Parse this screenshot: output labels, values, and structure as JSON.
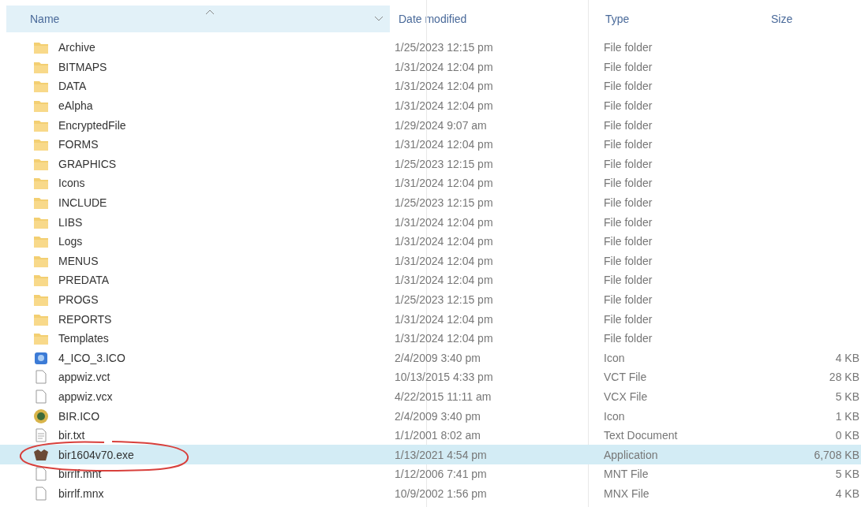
{
  "columns": [
    "Name",
    "Date modified",
    "Type",
    "Size"
  ],
  "rows": [
    {
      "kind": "folder",
      "name": "Archive",
      "date": "1/25/2023 12:15 pm",
      "type": "File folder",
      "selected": false,
      "circled": false
    },
    {
      "kind": "folder",
      "name": "BITMAPS",
      "date": "1/31/2024 12:04 pm",
      "type": "File folder",
      "selected": false,
      "circled": false
    },
    {
      "kind": "folder",
      "name": "DATA",
      "date": "1/31/2024 12:04 pm",
      "type": "File folder",
      "selected": false,
      "circled": false
    },
    {
      "kind": "folder",
      "name": "eAlpha",
      "date": "1/31/2024 12:04 pm",
      "type": "File folder",
      "selected": false,
      "circled": false
    },
    {
      "kind": "folder",
      "name": "EncryptedFile",
      "date": "1/29/2024 9:07 am",
      "type": "File folder",
      "selected": false,
      "circled": false
    },
    {
      "kind": "folder",
      "name": "FORMS",
      "date": "1/31/2024 12:04 pm",
      "type": "File folder",
      "selected": false,
      "circled": false
    },
    {
      "kind": "folder",
      "name": "GRAPHICS",
      "date": "1/25/2023 12:15 pm",
      "type": "File folder",
      "selected": false,
      "circled": false
    },
    {
      "kind": "folder",
      "name": "Icons",
      "date": "1/31/2024 12:04 pm",
      "type": "File folder",
      "selected": false,
      "circled": false
    },
    {
      "kind": "folder",
      "name": "INCLUDE",
      "date": "1/25/2023 12:15 pm",
      "type": "File folder",
      "selected": false,
      "circled": false
    },
    {
      "kind": "folder",
      "name": "LIBS",
      "date": "1/31/2024 12:04 pm",
      "type": "File folder",
      "selected": false,
      "circled": false
    },
    {
      "kind": "folder",
      "name": "Logs",
      "date": "1/31/2024 12:04 pm",
      "type": "File folder",
      "selected": false,
      "circled": false
    },
    {
      "kind": "folder",
      "name": "MENUS",
      "date": "1/31/2024 12:04 pm",
      "type": "File folder",
      "selected": false,
      "circled": false
    },
    {
      "kind": "folder",
      "name": "PREDATA",
      "date": "1/31/2024 12:04 pm",
      "type": "File folder",
      "selected": false,
      "circled": false
    },
    {
      "kind": "folder",
      "name": "PROGS",
      "date": "1/25/2023 12:15 pm",
      "type": "File folder",
      "selected": false,
      "circled": false
    },
    {
      "kind": "folder",
      "name": "REPORTS",
      "date": "1/31/2024 12:04 pm",
      "type": "File folder",
      "selected": false,
      "circled": false
    },
    {
      "kind": "folder",
      "name": "Templates",
      "date": "1/31/2024 12:04 pm",
      "type": "File folder",
      "selected": false,
      "circled": false
    },
    {
      "kind": "ico",
      "name": "4_ICO_3.ICO",
      "date": "2/4/2009 3:40 pm",
      "type": "Icon",
      "size": "4 KB",
      "selected": false,
      "circled": false
    },
    {
      "kind": "file",
      "name": "appwiz.vct",
      "date": "10/13/2015 4:33 pm",
      "type": "VCT File",
      "size": "28 KB",
      "selected": false,
      "circled": false
    },
    {
      "kind": "file",
      "name": "appwiz.vcx",
      "date": "4/22/2015 11:11 am",
      "type": "VCX File",
      "size": "5 KB",
      "selected": false,
      "circled": false
    },
    {
      "kind": "emblem",
      "name": "BIR.ICO",
      "date": "2/4/2009 3:40 pm",
      "type": "Icon",
      "size": "1 KB",
      "selected": false,
      "circled": false
    },
    {
      "kind": "text",
      "name": "bir.txt",
      "date": "1/1/2001 8:02 am",
      "type": "Text Document",
      "size": "0 KB",
      "selected": false,
      "circled": false
    },
    {
      "kind": "exe",
      "name": "bir1604v70.exe",
      "date": "1/13/2021 4:54 pm",
      "type": "Application",
      "size": "6,708 KB",
      "selected": true,
      "circled": true
    },
    {
      "kind": "file",
      "name": "birrlf.mnt",
      "date": "1/12/2006 7:41 pm",
      "type": "MNT File",
      "size": "5 KB",
      "selected": false,
      "circled": false
    },
    {
      "kind": "file",
      "name": "birrlf.mnx",
      "date": "10/9/2002 1:56 pm",
      "type": "MNX File",
      "size": "4 KB",
      "selected": false,
      "circled": false
    }
  ]
}
